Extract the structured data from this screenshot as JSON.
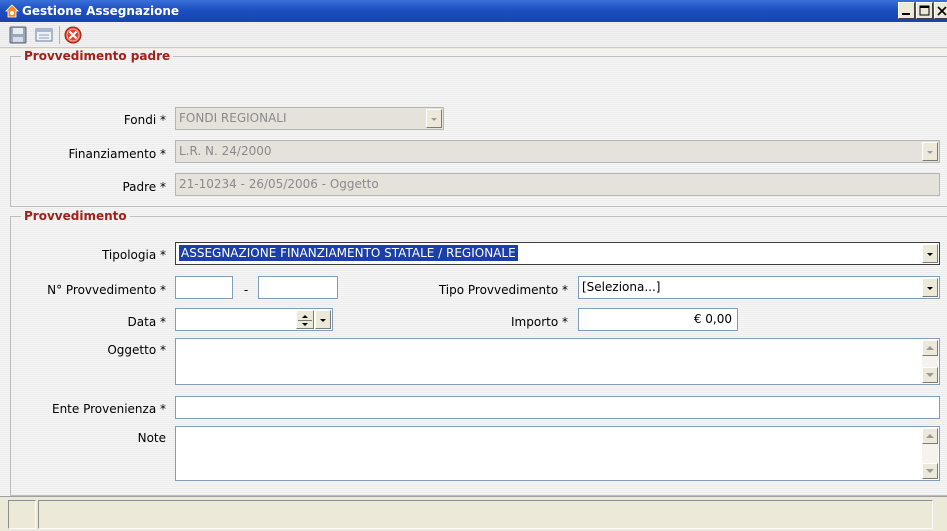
{
  "window": {
    "title": "Gestione Assegnazione",
    "controls": [
      "minimize",
      "maximize",
      "close"
    ]
  },
  "toolbar": {
    "buttons": [
      {
        "icon": "save-icon",
        "tooltip": ""
      },
      {
        "icon": "list-icon",
        "tooltip": ""
      },
      {
        "icon": "close-circle-icon",
        "tooltip": ""
      }
    ]
  },
  "groups": {
    "padre": {
      "title": "Provvedimento padre",
      "fondi": {
        "label": "Fondi *",
        "value": "FONDI REGIONALI"
      },
      "finanziamento": {
        "label": "Finanziamento *",
        "value": "L.R. N. 24/2000"
      },
      "padre": {
        "label": "Padre *",
        "value": "21-10234 - 26/05/2006 - Oggetto"
      }
    },
    "provvedimento": {
      "title": "Provvedimento",
      "tipologia": {
        "label": "Tipologia *",
        "value": "ASSEGNAZIONE FINANZIAMENTO STATALE / REGIONALE"
      },
      "numero": {
        "label": "N° Provvedimento *",
        "value_a": "",
        "separator": "-",
        "value_b": ""
      },
      "tipo": {
        "label": "Tipo Provvedimento *",
        "value": "[Seleziona...]"
      },
      "data": {
        "label": "Data *",
        "value": ""
      },
      "importo": {
        "label": "Importo *",
        "value": "€ 0,00"
      },
      "oggetto": {
        "label": "Oggetto *",
        "value": ""
      },
      "ente": {
        "label": "Ente Provenienza *",
        "value": ""
      },
      "note": {
        "label": "Note",
        "value": ""
      }
    }
  },
  "colors": {
    "group_title": "#a0211a",
    "selection": "#1a3fa8",
    "titlebar": "#1e4fc0"
  }
}
